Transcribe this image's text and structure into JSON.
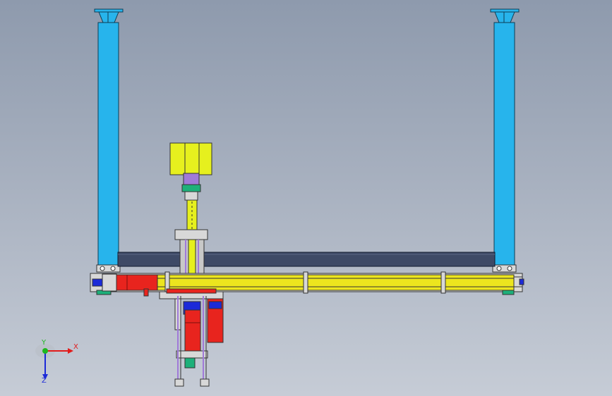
{
  "viewport": {
    "colors": {
      "background_top": "#8e9aad",
      "background_bottom": "#c6ccd6",
      "column": "#27b4ec",
      "beam": "#3e4a66",
      "rail": "#ece51e",
      "motor": "#e8241e",
      "head": "#e6f01e",
      "accent_purple": "#a07ad8",
      "accent_blue": "#1c2ad8"
    }
  },
  "triad": {
    "x_label": "X",
    "y_label": "Y",
    "z_label": "Z",
    "x_color": "#e21b1b",
    "y_color": "#1db71d",
    "z_color": "#1c2ad8"
  }
}
